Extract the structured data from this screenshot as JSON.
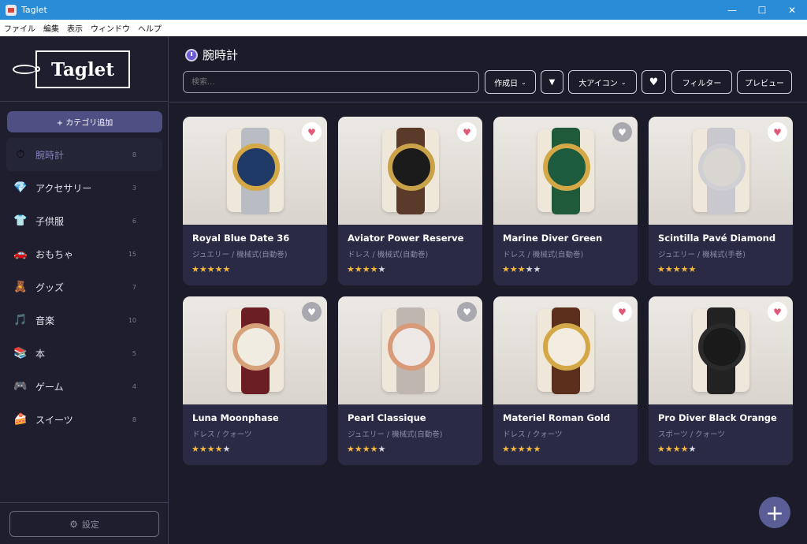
{
  "window": {
    "title": "Taglet",
    "minimize": "—",
    "maximize": "☐",
    "close": "✕"
  },
  "menu": [
    "ファイル",
    "編集",
    "表示",
    "ウィンドウ",
    "ヘルプ"
  ],
  "logo": "Taglet",
  "sidebar": {
    "add_category": "+ カテゴリ追加",
    "settings_label": "設定",
    "categories": [
      {
        "label": "腕時計",
        "count": "8",
        "icon": "⏱",
        "active": true
      },
      {
        "label": "アクセサリー",
        "count": "3",
        "icon": "💎"
      },
      {
        "label": "子供服",
        "count": "6",
        "icon": "👕"
      },
      {
        "label": "おもちゃ",
        "count": "15",
        "icon": "🚗"
      },
      {
        "label": "グッズ",
        "count": "7",
        "icon": "🧸"
      },
      {
        "label": "音楽",
        "count": "10",
        "icon": "🎵"
      },
      {
        "label": "本",
        "count": "5",
        "icon": "📚"
      },
      {
        "label": "ゲーム",
        "count": "4",
        "icon": "🎮"
      },
      {
        "label": "スイーツ",
        "count": "8",
        "icon": "🍰"
      }
    ]
  },
  "header": {
    "title": "腕時計",
    "search_placeholder": "検索...",
    "sort_label": "作成日",
    "sort_dir": "▼",
    "view_label": "大アイコン",
    "favorite_filter": "♥",
    "filter_label": "フィルター",
    "preview_label": "プレビュー"
  },
  "items": [
    {
      "name": "Royal Blue Date 36",
      "sub": "ジュエリー / 機械式(自動巻)",
      "rating": 5,
      "fav": true,
      "dial": "#1f3a66",
      "case": "#d4a847",
      "strap": "#b9bcc2"
    },
    {
      "name": "Aviator Power Reserve",
      "sub": "ドレス / 機械式(自動巻)",
      "rating": 4,
      "fav": true,
      "dial": "#1b1b1b",
      "case": "#c9a24a",
      "strap": "#5a3a28"
    },
    {
      "name": "Marine Diver Green",
      "sub": "ドレス / 機械式(自動巻)",
      "rating": 3,
      "fav": false,
      "dial": "#1d5b3e",
      "case": "#d4a847",
      "strap": "#1f5a3a"
    },
    {
      "name": "Scintilla Pavé Diamond",
      "sub": "ジュエリー / 機械式(手巻)",
      "rating": 5,
      "fav": true,
      "dial": "#d9d6d2",
      "case": "#cfcfd4",
      "strap": "#c8c8ce"
    },
    {
      "name": "Luna Moonphase",
      "sub": "ドレス / クォーツ",
      "rating": 4,
      "fav": false,
      "dial": "#f1ece2",
      "case": "#d6a07a",
      "strap": "#6b1f25"
    },
    {
      "name": "Pearl Classique",
      "sub": "ジュエリー / 機械式(自動巻)",
      "rating": 4,
      "fav": false,
      "dial": "#eee9e6",
      "case": "#d89a78",
      "strap": "#c0b6b0"
    },
    {
      "name": "Materiel Roman Gold",
      "sub": "ドレス / クォーツ",
      "rating": 5,
      "fav": true,
      "dial": "#f2ede0",
      "case": "#d4a847",
      "strap": "#5b2f1c"
    },
    {
      "name": "Pro Diver Black Orange",
      "sub": "スポーツ / クォーツ",
      "rating": 4,
      "fav": true,
      "dial": "#1a1a1a",
      "case": "#2a2a2a",
      "strap": "#222222"
    }
  ],
  "fab_label": "+"
}
